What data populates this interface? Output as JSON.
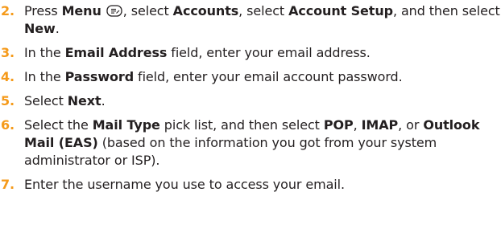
{
  "steps": [
    {
      "number": "2.",
      "text_1": "Press ",
      "bold_menu": "Menu",
      "icon": "menu-key-icon",
      "text_2": ", select ",
      "bold_accounts": "Accounts",
      "text_3": ", select ",
      "bold_account_setup": "Account Setup",
      "text_4": ", and then select ",
      "bold_new": "New",
      "text_5": "."
    },
    {
      "number": "3.",
      "text_1": "In the ",
      "bold_1": "Email Address",
      "text_2": " field, enter your email address."
    },
    {
      "number": "4.",
      "text_1": "In the ",
      "bold_1": "Password",
      "text_2": " field, enter your email account password."
    },
    {
      "number": "5.",
      "text_1": "Select ",
      "bold_1": "Next",
      "text_2": "."
    },
    {
      "number": "6.",
      "text_1": "Select the ",
      "bold_mail_type": "Mail Type",
      "text_2": " pick list, and then select ",
      "bold_pop": "POP",
      "text_3": ", ",
      "bold_imap": "IMAP",
      "text_4": ", or ",
      "bold_outlook": "Outlook Mail (EAS)",
      "text_5": " (based on the information you got from your system administrator or ISP)."
    },
    {
      "number": "7.",
      "text_1": "Enter the username you use to access your email."
    }
  ],
  "colors": {
    "step_number": "#f59a1a",
    "text": "#231f20"
  }
}
